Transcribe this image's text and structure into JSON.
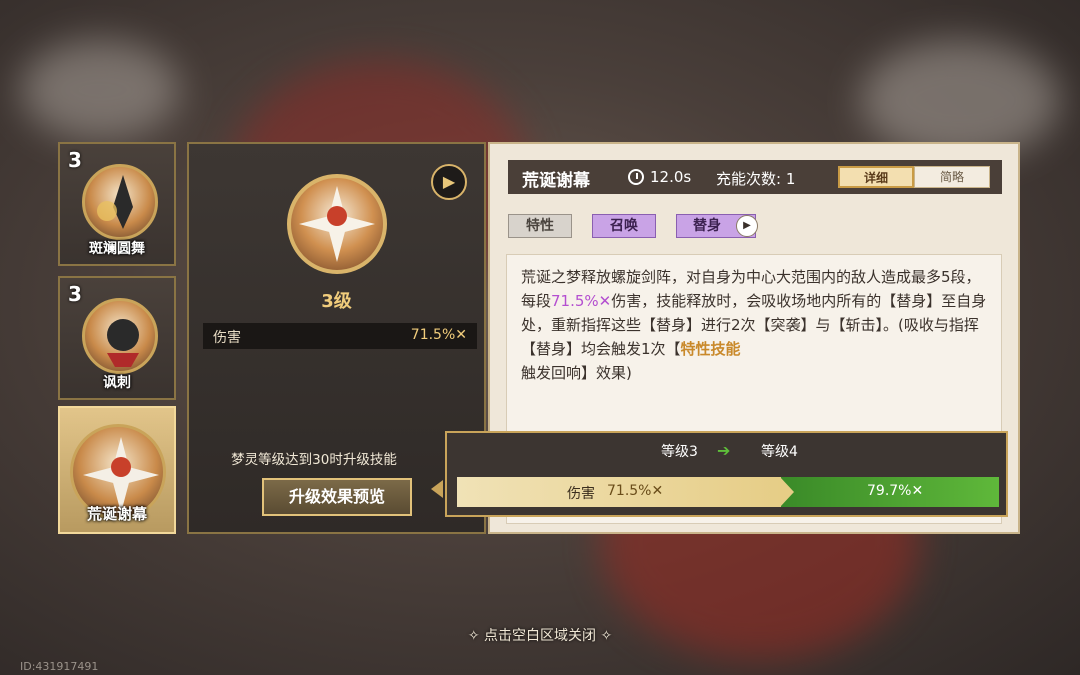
{
  "skills": [
    {
      "level": "3",
      "name": "斑斓圆舞"
    },
    {
      "level": "3",
      "name": "讽刺"
    },
    {
      "level": "",
      "name": "荒诞谢幕"
    }
  ],
  "detail": {
    "level_label": "3级",
    "stat_label": "伤害",
    "stat_value": "71.5%✕",
    "upgrade_hint": "梦灵等级达到30时升级技能",
    "preview_button": "升级效果预览"
  },
  "info": {
    "title": "荒诞谢幕",
    "cooldown": "12.0s",
    "charges": "充能次数: 1",
    "tab_detail": "详细",
    "tab_brief": "简略",
    "tags": [
      "特性",
      "召唤",
      "替身"
    ],
    "desc_parts": [
      "荒诞之梦释放螺旋剑阵，对自身为中心大范围内的敌人造成最多5段，每段",
      "71.5%✕",
      "伤害，技能释放时，会吸收场地内所有的【替身】至自身处，重新指挥这些【替身】进行2次【突袭】与【斩击】。(吸收与指挥【替身】均会触发1次【",
      "特性技能",
      "触发回响】效果)"
    ]
  },
  "popup": {
    "level_from": "等级3",
    "level_to": "等级4",
    "stat_label": "伤害",
    "old_value": "71.5%✕",
    "new_value": "79.7%✕"
  },
  "footer": {
    "close_hint": "✧ 点击空白区域关闭 ✧",
    "id_text": "ID:431917491"
  },
  "colors": {
    "gold_accent": "#f1cd7c",
    "summon_purple": "#c9a3e6",
    "upgrade_green": "#5fb83a"
  }
}
